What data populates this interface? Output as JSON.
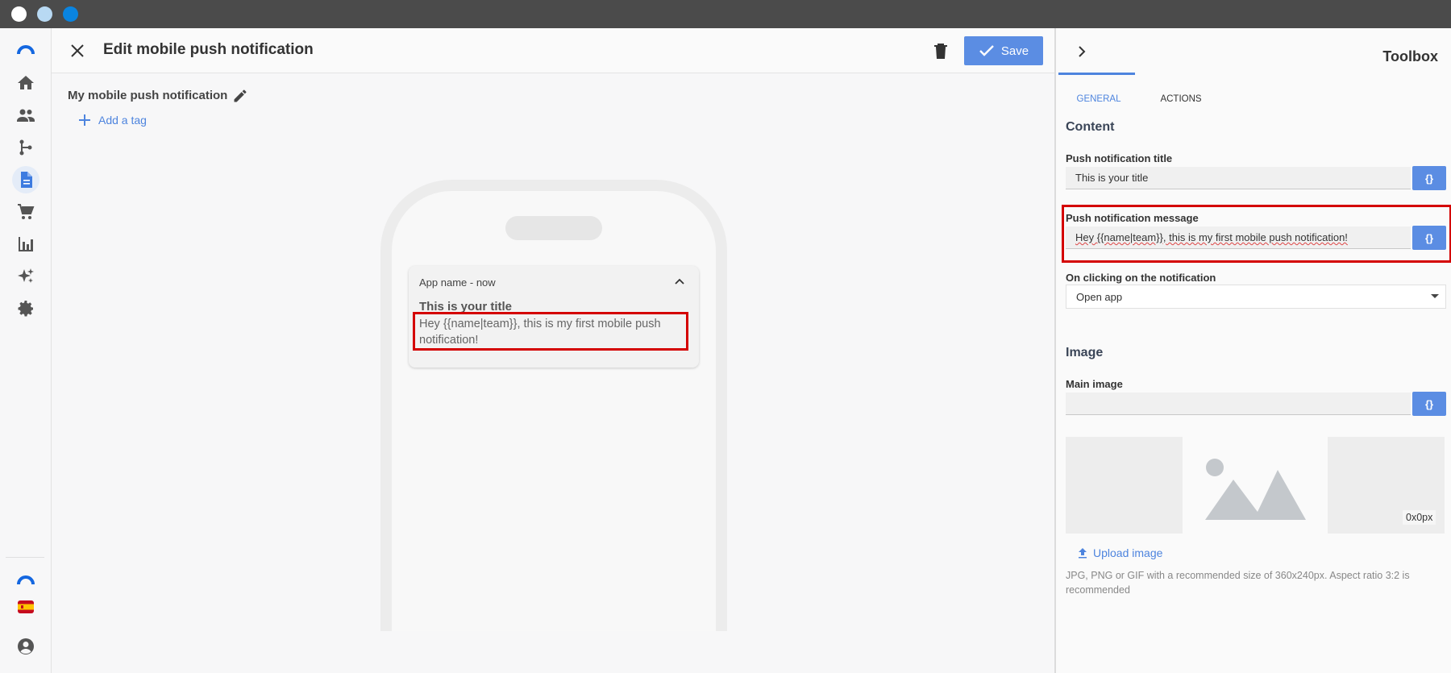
{
  "window": {
    "dots": [
      {
        "name": "window-dot-1",
        "color": "#ffffff"
      },
      {
        "name": "window-dot-2",
        "color": "#b8d9f3"
      },
      {
        "name": "window-dot-3",
        "color": "#0a84e0"
      }
    ]
  },
  "sidebar": {
    "items": [
      {
        "name": "sidebar-item-home",
        "icon": "home-icon"
      },
      {
        "name": "sidebar-item-contacts",
        "icon": "people-icon"
      },
      {
        "name": "sidebar-item-automations",
        "icon": "branch-icon"
      },
      {
        "name": "sidebar-item-templates",
        "icon": "document-icon",
        "active": true
      },
      {
        "name": "sidebar-item-ecommerce",
        "icon": "cart-icon"
      },
      {
        "name": "sidebar-item-statistics",
        "icon": "bar-chart-icon"
      },
      {
        "name": "sidebar-item-ai",
        "icon": "sparkles-icon"
      },
      {
        "name": "sidebar-item-settings",
        "icon": "gear-icon"
      }
    ],
    "bottom": [
      {
        "name": "brand-logo",
        "icon": "brand-arc-icon"
      },
      {
        "name": "language-spain",
        "icon": "spain-flag-icon"
      },
      {
        "name": "account",
        "icon": "account-circle-icon"
      }
    ]
  },
  "header": {
    "title": "Edit mobile push notification",
    "save_label": "Save"
  },
  "editor": {
    "notification_name": "My mobile push notification",
    "add_tag_label": "Add a tag"
  },
  "preview": {
    "app_line": "App name - now",
    "title": "This is your title",
    "message": "Hey {{name|team}}, this is my first mobile push notification!"
  },
  "toolbox": {
    "title": "Toolbox",
    "tabs": [
      {
        "label": "GENERAL",
        "active": true
      },
      {
        "label": "ACTIONS",
        "active": false
      }
    ],
    "content_heading": "Content",
    "title_label": "Push notification title",
    "title_value": "This is your title",
    "message_label": "Push notification message",
    "message_value": "Hey {{name|team}}, this is my first mobile push notification!",
    "var_button_label": "{}",
    "click_label": "On clicking on the notification",
    "click_value": "Open app",
    "image_heading": "Image",
    "main_image_label": "Main image",
    "main_image_value": "",
    "image_dims": "0x0px",
    "upload_label": "Upload image",
    "help_text": "JPG, PNG or GIF with a recommended size of 360x240px. Aspect ratio 3:2 is recommended"
  },
  "colors": {
    "accent": "#5b8de3",
    "highlight": "#d40000"
  }
}
